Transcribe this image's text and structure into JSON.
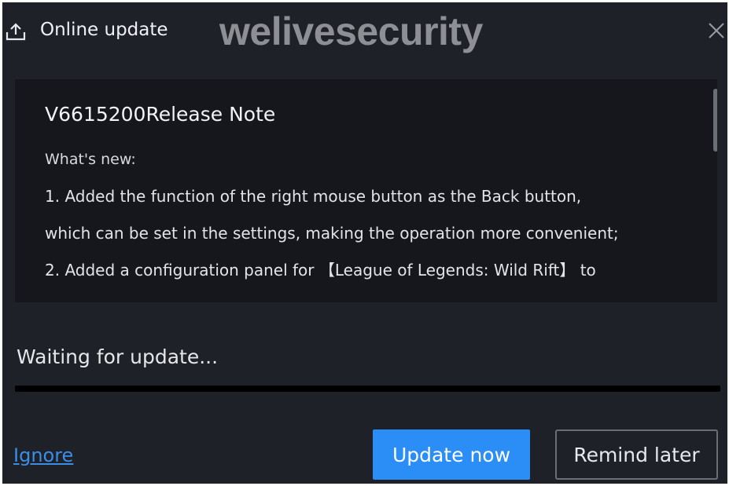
{
  "window": {
    "title": "Online update",
    "title_icon": "upload-icon",
    "close_icon": "close-icon"
  },
  "watermark": "welivesecurity",
  "release_notes": {
    "title": "V6615200Release Note",
    "heading": "What's new:",
    "lines": [
      "1. Added the function of the right mouse button as the Back button,",
      "which can be set in the settings, making the operation more convenient;",
      "2. Added a configuration panel for 【League of Legends: Wild Rift】 to"
    ]
  },
  "status": {
    "text": "Waiting for update...",
    "progress": 0
  },
  "actions": {
    "ignore_label": "Ignore",
    "update_label": "Update now",
    "remind_label": "Remind later"
  },
  "colors": {
    "background": "#1e2128",
    "panel": "#15171c",
    "accent": "#2a8ef6",
    "link": "#3a8ee6"
  }
}
